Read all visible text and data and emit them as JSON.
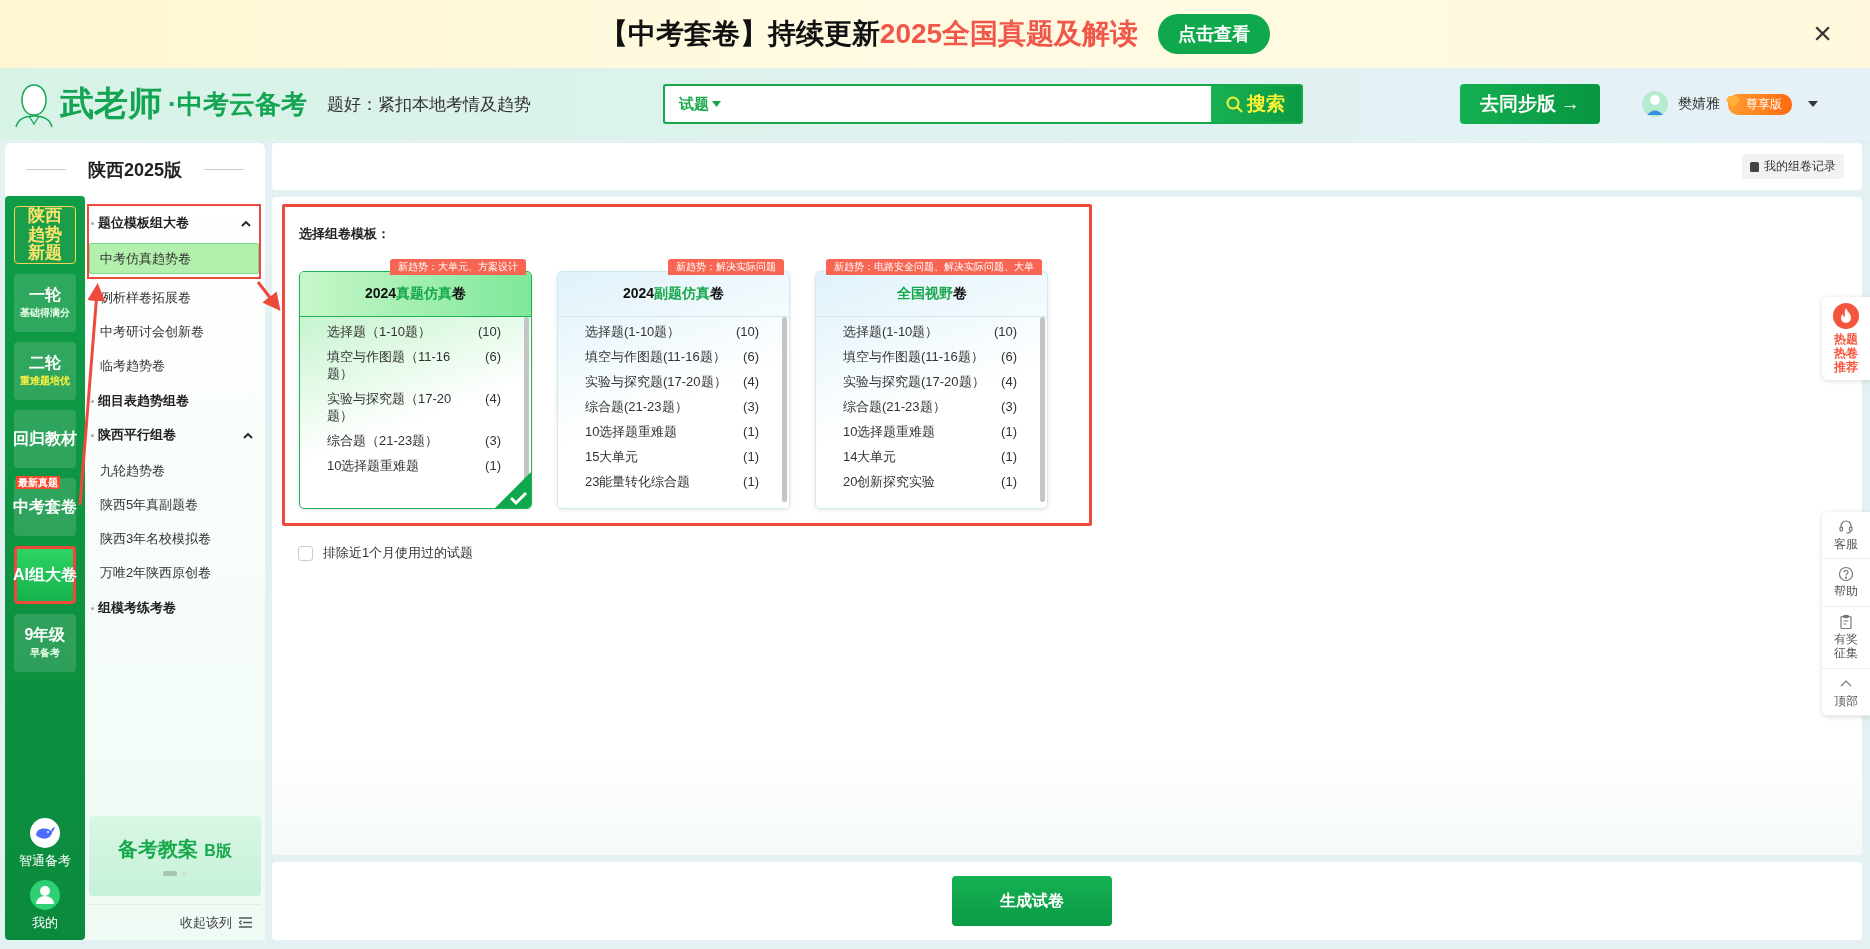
{
  "banner": {
    "text": "【中考套卷】持续更新",
    "highlight": "2025全国真题及解读",
    "button": "点击查看",
    "close": "×"
  },
  "header": {
    "brand": "武老师",
    "brand_dot": "·",
    "product": "中考云备考",
    "slogan": "题好：紧扣本地考情及趋势",
    "search": {
      "scope": "试题",
      "button": "搜索"
    },
    "sync_button": "去同步版 →",
    "user": {
      "name": "樊婧雅",
      "badge": "尊享版"
    }
  },
  "edition": "陕西2025版",
  "nav": [
    {
      "kind": "trend",
      "label": "陕西趋势新题",
      "selected": false,
      "highlighted": false
    },
    {
      "kind": "round",
      "label": "一轮",
      "sub": "基础得满分",
      "selected": false,
      "highlighted": false
    },
    {
      "kind": "round",
      "label": "二轮",
      "sub": "重难题培优",
      "selected": false,
      "highlighted": false
    },
    {
      "kind": "plain",
      "label": "回归教材",
      "selected": false,
      "highlighted": false
    },
    {
      "kind": "plain",
      "label": "中考套卷",
      "tag": "最新真题",
      "selected": false,
      "highlighted": false
    },
    {
      "kind": "plain",
      "label": "AI组大卷",
      "selected": true,
      "highlighted": true
    },
    {
      "kind": "round",
      "label": "9年级",
      "sub": "早备考",
      "selected": false,
      "highlighted": false
    }
  ],
  "nav_bottom": [
    {
      "kind": "whale",
      "label": "智通备考"
    },
    {
      "kind": "user",
      "label": "我的"
    }
  ],
  "groups": [
    {
      "title": "题位模板组大卷",
      "expanded": true,
      "highlighted": true,
      "children": [
        {
          "label": "中考仿真趋势卷",
          "selected": true
        },
        {
          "label": "例析样卷拓展卷",
          "selected": false
        },
        {
          "label": "中考研讨会创新卷",
          "selected": false
        },
        {
          "label": "临考趋势卷",
          "selected": false
        }
      ]
    },
    {
      "title": "细目表趋势组卷",
      "highlighted": false
    },
    {
      "title": "陕西平行组卷",
      "expanded": true,
      "highlighted": false,
      "children": [
        {
          "label": "九轮趋势卷",
          "selected": false
        },
        {
          "label": "陕西5年真副题卷",
          "selected": false
        },
        {
          "label": "陕西3年名校模拟卷",
          "selected": false
        },
        {
          "label": "万唯2年陕西原创卷",
          "selected": false
        }
      ]
    },
    {
      "title": "组模考练考卷",
      "highlighted": false
    }
  ],
  "promo": {
    "title": "备考教案",
    "suffix": "B版"
  },
  "collapse": "收起该列",
  "records_button": "我的组卷记录",
  "template_panel": {
    "label": "选择组卷模板：",
    "highlighted": true,
    "templates": [
      {
        "tag": "新趋势：大单元、方案设计",
        "selected": true,
        "title_parts": [
          {
            "text": "2024",
            "accent": false
          },
          {
            "text": "真题仿真",
            "accent": true
          },
          {
            "text": "卷",
            "accent": false
          }
        ],
        "rows": [
          {
            "name": "选择题（1-10题）",
            "count": "(10)"
          },
          {
            "name": "填空与作图题（11-16题）",
            "count": "(6)"
          },
          {
            "name": "实验与探究题（17-20题）",
            "count": "(4)"
          },
          {
            "name": "综合题（21-23题）",
            "count": "(3)"
          },
          {
            "name": "10选择题重难题",
            "count": "(1)"
          }
        ]
      },
      {
        "tag": "新趋势：解决实际问题",
        "selected": false,
        "title_parts": [
          {
            "text": "2024",
            "accent": false
          },
          {
            "text": "副题仿真",
            "accent": true
          },
          {
            "text": "卷",
            "accent": false
          }
        ],
        "rows": [
          {
            "name": "选择题(1-10题）",
            "count": "(10)"
          },
          {
            "name": "填空与作图题(11-16题）",
            "count": "(6)"
          },
          {
            "name": "实验与探究题(17-20题）",
            "count": "(4)"
          },
          {
            "name": "综合题(21-23题）",
            "count": "(3)"
          },
          {
            "name": "10选择题重难题",
            "count": "(1)"
          },
          {
            "name": "15大单元",
            "count": "(1)"
          },
          {
            "name": "23能量转化综合题",
            "count": "(1)"
          }
        ]
      },
      {
        "tag": "新趋势：电路安全问题、解决实际问题、大单",
        "selected": false,
        "title_parts": [
          {
            "text": "全国视野",
            "accent": true
          },
          {
            "text": "卷",
            "accent": false
          }
        ],
        "rows": [
          {
            "name": "选择题(1-10题）",
            "count": "(10)"
          },
          {
            "name": "填空与作图题(11-16题）",
            "count": "(6)"
          },
          {
            "name": "实验与探究题(17-20题）",
            "count": "(4)"
          },
          {
            "name": "综合题(21-23题）",
            "count": "(3)"
          },
          {
            "name": "10选择题重难题",
            "count": "(1)"
          },
          {
            "name": "14大单元",
            "count": "(1)"
          },
          {
            "name": "20创新探究实验",
            "count": "(1)"
          }
        ]
      }
    ]
  },
  "exclude": {
    "label": "排除近1个月使用过的试题",
    "checked": false
  },
  "generate_button": "生成试卷",
  "float_hot": "热题热卷推荐",
  "float_tools": [
    {
      "kind": "headset",
      "label": "客服"
    },
    {
      "kind": "help",
      "label": "帮助"
    },
    {
      "kind": "clipboard",
      "label": "有奖征集"
    },
    {
      "kind": "top",
      "label": "顶部"
    }
  ]
}
